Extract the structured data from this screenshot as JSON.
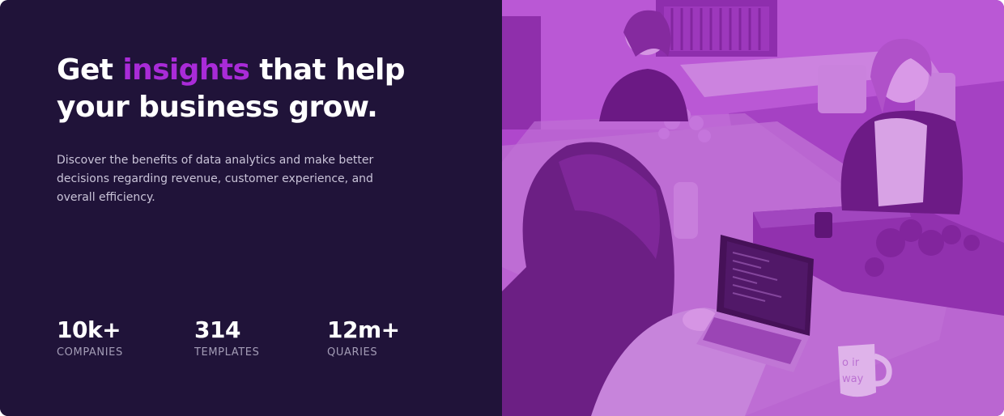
{
  "hero": {
    "headline_before": "Get ",
    "headline_accent": "insights",
    "headline_after": " that help your business grow.",
    "description": "Discover the benefits of data analytics and make better decisions regarding revenue, customer experience, and overall efficiency."
  },
  "stats": [
    {
      "value": "10k+",
      "label": "COMPANIES"
    },
    {
      "value": "314",
      "label": "TEMPLATES"
    },
    {
      "value": "12m+",
      "label": "QUARIES"
    }
  ],
  "colors": {
    "background": "#201339",
    "accent": "#a92bd8",
    "image_tint": "#a12fbf"
  },
  "image": {
    "description_icon": "office-team-photo",
    "mug_text": "o ir\nway"
  }
}
